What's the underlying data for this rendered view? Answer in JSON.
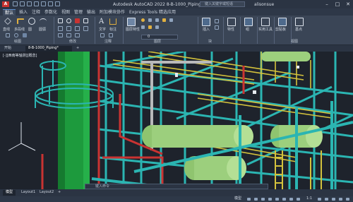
{
  "titlebar": {
    "app_icon_letter": "A",
    "title": "Autodesk AutoCAD 2022   8-B-1000_Piping.dwg",
    "search_placeholder": "键入关键字或短语",
    "user": "alisonsue",
    "minimize": "–",
    "maximize": "□",
    "close": "✕"
  },
  "menu": {
    "tabs": [
      "默认",
      "插入",
      "注释",
      "参数化",
      "视图",
      "管理",
      "输出",
      "附加模块",
      "协作",
      "Express Tools",
      "精选应用"
    ],
    "active_index": 0
  },
  "ribbon": {
    "draw_tools": [
      "直线",
      "多段线",
      "圆",
      "圆弧"
    ],
    "modify_label": "修改",
    "text_tool": "文字",
    "dimension_tool": "标注",
    "layer_props": "图层特性",
    "layer_current": "0",
    "insert_label": "插入",
    "block_label": "块",
    "properties_label": "特性",
    "groups_label": "组",
    "utilities_label": "实用工具",
    "clipboard_label": "剪贴板",
    "base_label": "基点",
    "view_label": "视图",
    "panels": {
      "draw": "绘图",
      "modify": "修改",
      "annotation": "注释",
      "layers": "图层",
      "block": "块",
      "view": "视图"
    }
  },
  "doc_tabs": {
    "start": "开始",
    "file": "8-B-1000_Piping*",
    "add": "+"
  },
  "viewport": {
    "label": "[-][西南等轴测][概念]"
  },
  "layout_tabs": [
    "模型",
    "Layout1",
    "Layout2"
  ],
  "layout_add": "+",
  "command_line": {
    "placeholder": "键入命令"
  },
  "status": {
    "model": "模型",
    "scale": "1:1"
  },
  "colors": {
    "cyan_steel": "#2bb5b2",
    "yellow_rail": "#d4c23c",
    "green_vessel": "#9ccf7d",
    "red_pipe": "#c93332",
    "dark_green_column": "#1d9a3d"
  }
}
